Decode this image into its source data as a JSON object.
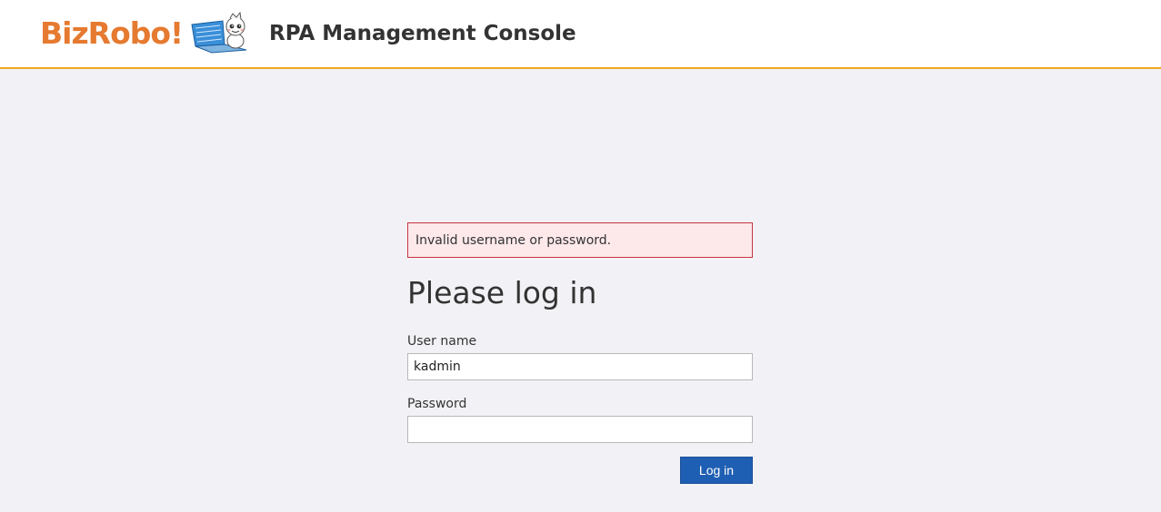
{
  "header": {
    "logo_text": "BizRobo!",
    "logo_mascot": "robot-mascot-with-laptop",
    "app_title": "RPA Management Console"
  },
  "login": {
    "error_message": "Invalid username or password.",
    "heading": "Please log in",
    "username_label": "User name",
    "username_value": "kadmin",
    "password_label": "Password",
    "password_value": "",
    "submit_label": "Log in"
  },
  "colors": {
    "brand_orange": "#e57a30",
    "header_border": "#f0a81c",
    "error_border": "#c8333f",
    "error_background": "#fde8ea",
    "primary_button": "#1f5fb3",
    "page_background": "#f2f2f6"
  }
}
